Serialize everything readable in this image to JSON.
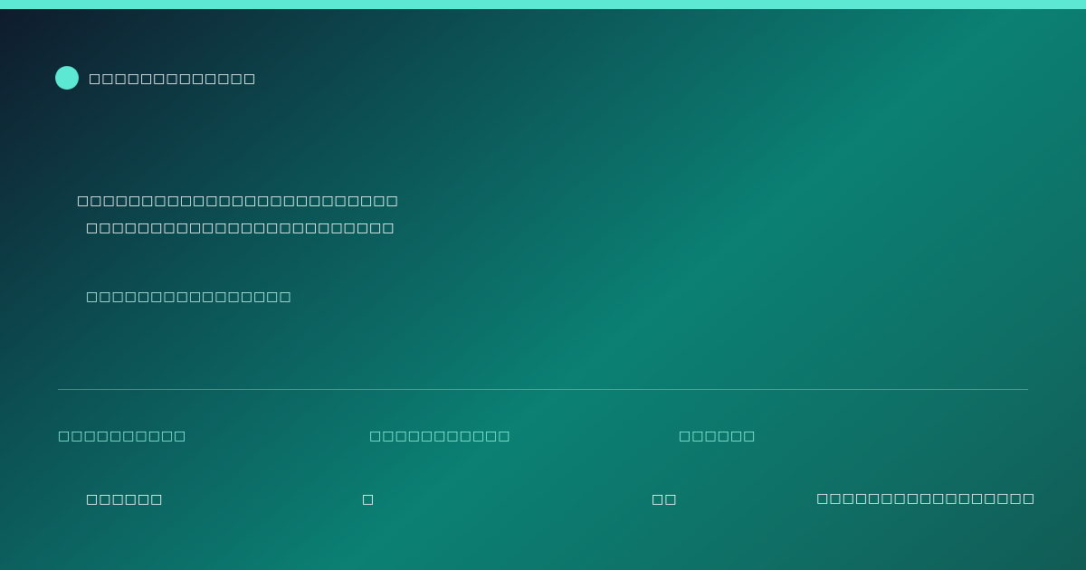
{
  "brand": {
    "name": "□□□□□□□□□□□□□"
  },
  "hero": {
    "headline_line1": "□□□□□□□□□□□□□□□□□□□□□□□□□",
    "headline_line2": "□□□□□□□□□□□□□□□□□□□□□□□□",
    "subtitle": "□□□□□□□□□□□□□□□□"
  },
  "stats": [
    {
      "label": "□□□□□□□□□□",
      "value": "□□□□□□"
    },
    {
      "label": "□□□□□□□□□□□",
      "value": "□"
    },
    {
      "label": "□□□□□□",
      "value": "□□"
    }
  ],
  "footer": {
    "note": "□□□□□□□□□□□□□□□□□"
  },
  "colors": {
    "accent": "#5de8d4",
    "background_start": "#0f1a2c",
    "background_mid": "#0b8073",
    "background_end": "#115c55"
  }
}
